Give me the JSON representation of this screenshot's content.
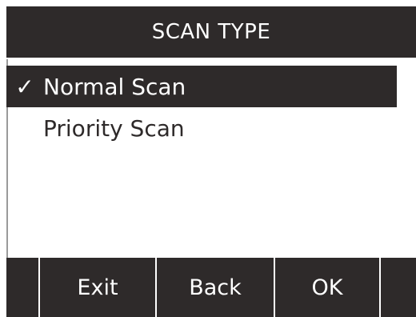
{
  "title": "SCAN TYPE",
  "check_mark": "✓",
  "menu": {
    "items": [
      {
        "label": "Normal Scan",
        "selected": true,
        "checked": true
      },
      {
        "label": "Priority Scan",
        "selected": false,
        "checked": false
      }
    ]
  },
  "softkeys": {
    "k0": "",
    "exit": "Exit",
    "back": "Back",
    "ok": "OK",
    "k4": ""
  },
  "colors": {
    "background": "#ffffff",
    "bar": "#2e2a2a",
    "text_on_bar": "#ffffff",
    "text": "#2e2a2a"
  }
}
